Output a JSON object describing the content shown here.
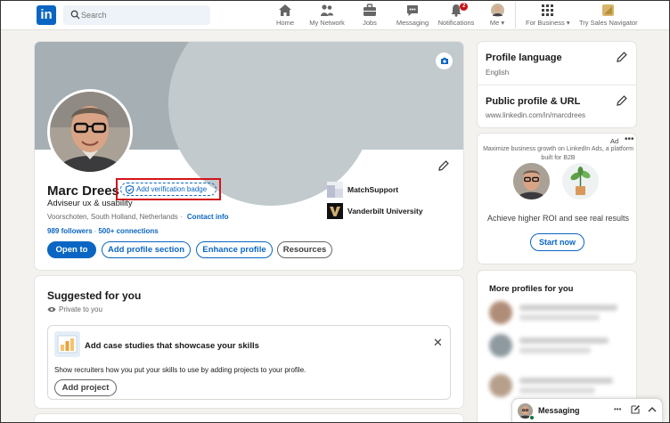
{
  "nav": {
    "logo": "in",
    "search_placeholder": "Search",
    "items": [
      {
        "label": "Home",
        "icon": "home-icon"
      },
      {
        "label": "My Network",
        "icon": "network-icon"
      },
      {
        "label": "Jobs",
        "icon": "briefcase-icon"
      },
      {
        "label": "Messaging",
        "icon": "messaging-icon"
      },
      {
        "label": "Notifications",
        "icon": "bell-icon",
        "badge": "2"
      },
      {
        "label": "Me",
        "icon": "avatar"
      },
      {
        "label": "For Business",
        "icon": "grid-icon"
      },
      {
        "label": "Try Sales Navigator",
        "icon": "sales-navigator-icon"
      }
    ]
  },
  "profile": {
    "name": "Marc Drees",
    "verify_label": "Add verification badge",
    "headline": "Adviseur ux & usability",
    "location": "Voorschoten, South Holland, Netherlands",
    "location_sep": "·",
    "contact_info": "Contact info",
    "followers": "989 followers",
    "connections_sep": "·",
    "connections": "500+ connections",
    "buttons": {
      "open_to": "Open to",
      "add_section": "Add profile section",
      "enhance": "Enhance profile",
      "resources": "Resources"
    },
    "orgs": [
      {
        "name": "MatchSupport"
      },
      {
        "name": "Vanderbilt University"
      }
    ]
  },
  "suggested": {
    "title": "Suggested for you",
    "privacy": "Private to you",
    "card_title": "Add case studies that showcase your skills",
    "card_desc": "Show recruiters how you put your skills to use by adding projects to your profile.",
    "card_button": "Add project",
    "close": "✕"
  },
  "sidebar": {
    "language_title": "Profile language",
    "language_value": "English",
    "url_title": "Public profile & URL",
    "url_value": "www.linkedin.com/in/marcdrees"
  },
  "ad": {
    "label": "Ad",
    "dots": "•••",
    "text": "Maximize business growth on LinkedIn Ads, a platform built for B2B",
    "headline": "Achieve higher ROI and see real results",
    "button": "Start now"
  },
  "more_profiles": {
    "title": "More profiles for you"
  },
  "messaging": {
    "label": "Messaging",
    "dots": "•••"
  },
  "colors": {
    "brand": "#0a66c2",
    "highlight_box": "#d1151b",
    "background": "#f4f2ee"
  }
}
